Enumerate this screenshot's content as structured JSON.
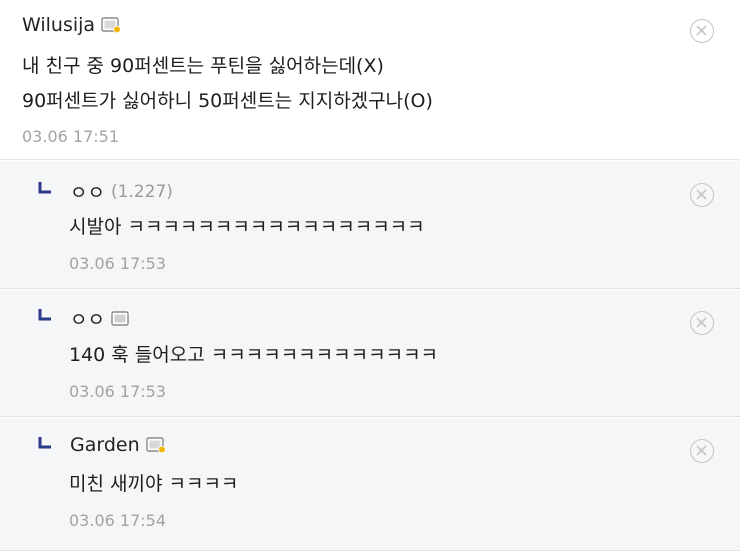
{
  "comments": [
    {
      "author": "Wilusija",
      "body": [
        "내 친구 중 90퍼센트는 푸틴을 싫어하는데(X)",
        "90퍼센트가 싫어하니 50퍼센트는 지지하겠구나(O)"
      ],
      "date": "03.06 17:51",
      "level_icon": "badge-gold-icon"
    }
  ],
  "replies": [
    {
      "author": "ㅇㅇ",
      "ip": "(1.227)",
      "body": "시발아 ㅋㅋㅋㅋㅋㅋㅋㅋㅋㅋㅋㅋㅋㅋㅋㅋㅋ",
      "date": "03.06 17:53"
    },
    {
      "author": "ㅇㅇ",
      "body": "140 훅 들어오고 ㅋㅋㅋㅋㅋㅋㅋㅋㅋㅋㅋㅋㅋ",
      "date": "03.06 17:53",
      "level_icon": "badge-gray-icon"
    },
    {
      "author": "Garden",
      "body": "미친 새끼야 ㅋㅋㅋㅋ",
      "date": "03.06 17:54",
      "level_icon": "badge-gold-icon"
    }
  ],
  "colors": {
    "reply_background": "#f5f6f8",
    "date_text": "#a3a3a3",
    "reply_arrow": "#2b3a8a"
  }
}
